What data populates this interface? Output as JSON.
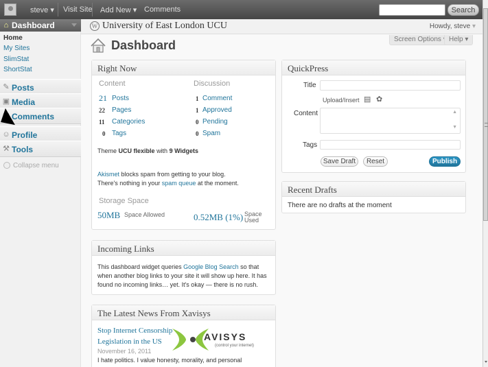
{
  "adminbar": {
    "user": "steve",
    "visit_site": "Visit Site",
    "add_new": "Add New",
    "comments": "Comments",
    "search_placeholder": "",
    "search_button": "Search"
  },
  "sidebar": {
    "dashboard": "Dashboard",
    "submenu": [
      "Home",
      "My Sites",
      "SlimStat",
      "ShortStat"
    ],
    "items": [
      "Posts",
      "Media",
      "Comments",
      "Profile",
      "Tools"
    ],
    "collapse": "Collapse menu"
  },
  "header": {
    "site_title": "University of East London UCU",
    "howdy": "Howdy, steve",
    "screen_options": "Screen Options",
    "help": "Help",
    "page_title": "Dashboard"
  },
  "right_now": {
    "title": "Right Now",
    "content_head": "Content",
    "discussion_head": "Discussion",
    "content": [
      {
        "count": "21",
        "label": "Posts"
      },
      {
        "count": "22",
        "label": "Pages"
      },
      {
        "count": "11",
        "label": "Categories"
      },
      {
        "count": "0",
        "label": "Tags"
      }
    ],
    "discussion": [
      {
        "count": "1",
        "label": "Comment"
      },
      {
        "count": "1",
        "label": "Approved"
      },
      {
        "count": "0",
        "label": "Pending"
      },
      {
        "count": "0",
        "label": "Spam"
      }
    ],
    "theme_prefix": "Theme",
    "theme_name": "UCU flexible",
    "theme_mid": "with",
    "theme_widgets": "9 Widgets",
    "akismet_link": "Akismet",
    "akismet_text": "blocks spam from getting to your blog.",
    "spam_prefix": "There's nothing in your",
    "spam_link": "spam queue",
    "spam_suffix": "at the moment.",
    "storage_head": "Storage Space",
    "allowed_value": "50MB",
    "allowed_label": "Space Allowed",
    "used_value": "0.52MB (1%)",
    "used_label_1": "Space",
    "used_label_2": "Used"
  },
  "incoming": {
    "title": "Incoming Links",
    "text_1": "This dashboard widget queries",
    "link": "Google Blog Search",
    "text_2": "so that when",
    "text_3": "another blog links to your site it will show up here. It has found no",
    "text_4": "incoming links… yet. It's okay — there is no rush."
  },
  "news": {
    "title": "The Latest News From Xavisys",
    "headline_1": "Stop Internet Censorship",
    "headline_2": "Legislation in the US",
    "date": "November 16, 2011",
    "excerpt": "I hate politics. I value honesty, morality, and personal",
    "logo_text": "AVISYS",
    "logo_tag": "(control your internet)"
  },
  "quickpress": {
    "title": "QuickPress",
    "title_label": "Title",
    "upload_label": "Upload/Insert",
    "content_label": "Content",
    "tags_label": "Tags",
    "save_draft": "Save Draft",
    "reset": "Reset",
    "publish": "Publish"
  },
  "drafts": {
    "title": "Recent Drafts",
    "text": "There are no drafts at the moment"
  }
}
